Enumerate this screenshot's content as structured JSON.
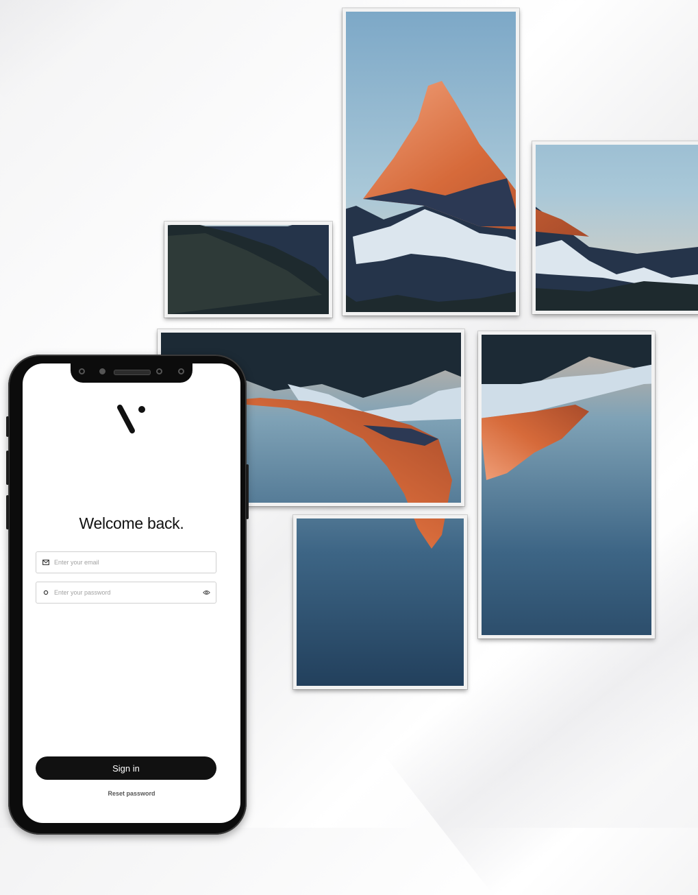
{
  "login": {
    "title": "Welcome back.",
    "email_placeholder": "Enter your email",
    "password_placeholder": "Enter your password",
    "signin_label": "Sign in",
    "reset_label": "Reset password"
  },
  "icons": {
    "logo": "brand-logo",
    "email": "mail-icon",
    "password": "lock-icon",
    "toggle": "eye-icon"
  },
  "colors": {
    "button": "#111111",
    "sky": "#8db4cf",
    "peak": "#d96b3c",
    "water": "#24425f"
  }
}
